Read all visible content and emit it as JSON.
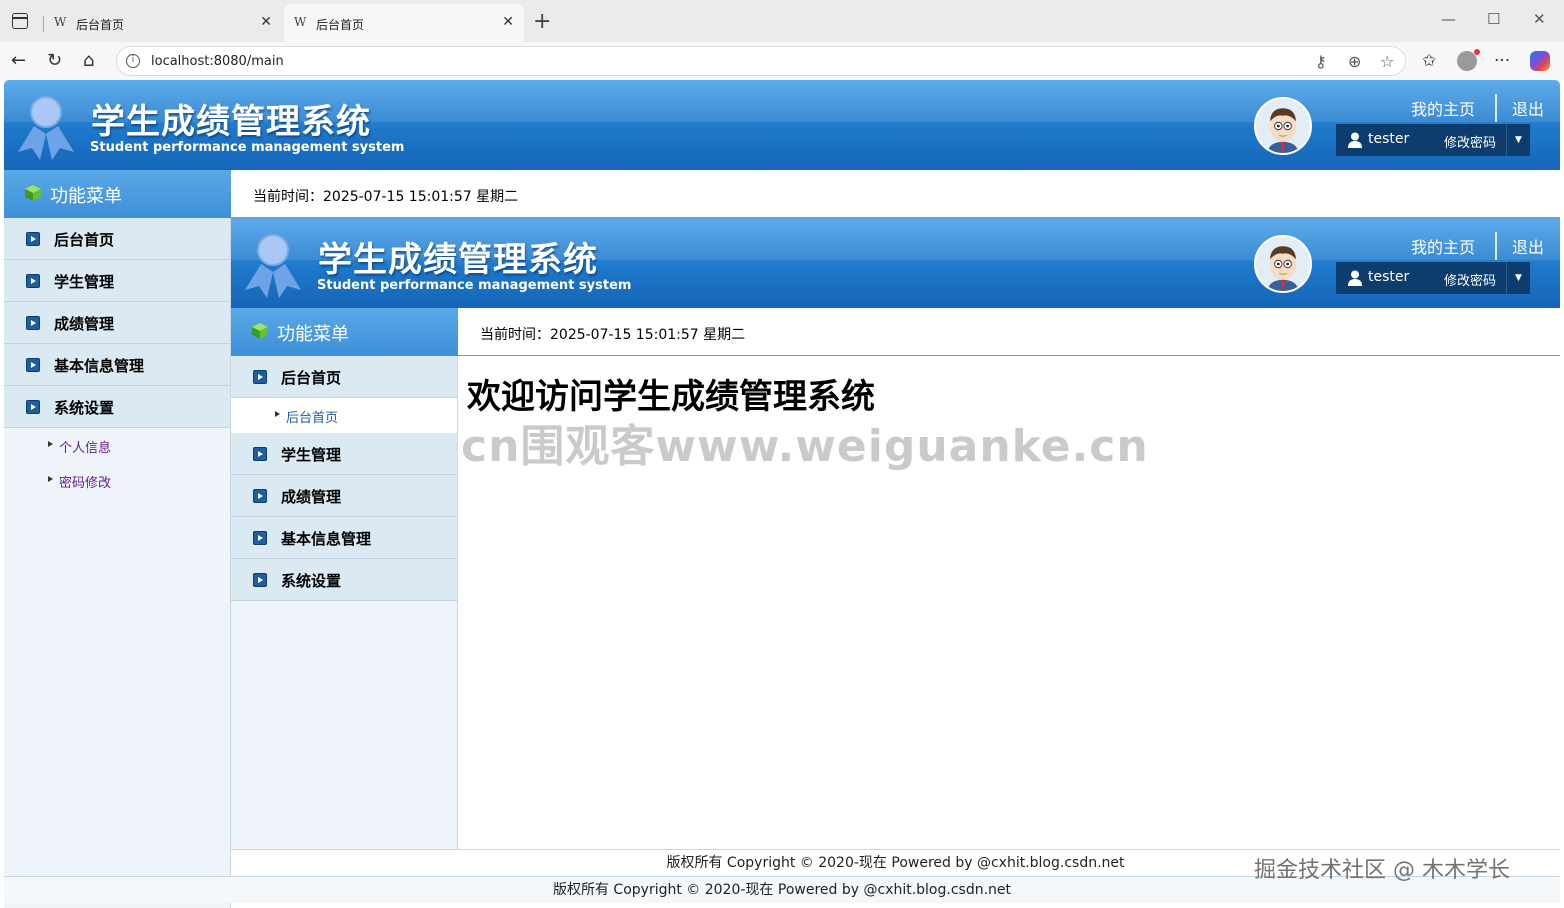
{
  "browser": {
    "tabs": [
      {
        "favicon": "W",
        "title": "后台首页"
      },
      {
        "favicon": "W",
        "title": "后台首页"
      }
    ],
    "url": "localhost:8080/main"
  },
  "header": {
    "title": "学生成绩管理系统",
    "subtitle": "Student performance management system",
    "my_home": "我的主页",
    "logout": "退出",
    "username": "tester",
    "change_password": "修改密码"
  },
  "menu": {
    "title": "功能菜单",
    "current_time": "当前时间：2025-07-15 15:01:57 星期二",
    "items": [
      {
        "label": "后台首页"
      },
      {
        "label": "学生管理"
      },
      {
        "label": "成绩管理"
      },
      {
        "label": "基本信息管理"
      },
      {
        "label": "系统设置"
      }
    ],
    "settings_sub": [
      {
        "label": "个人信息"
      },
      {
        "label": "密码修改"
      }
    ],
    "home_sub": [
      {
        "label": "后台首页"
      }
    ]
  },
  "content": {
    "welcome": "欢迎访问学生成绩管理系统"
  },
  "footer": {
    "text": "版权所有 Copyright © 2020-现在 Powered by @cxhit.blog.csdn.net"
  },
  "watermarks": {
    "main": "cn围观客www.weiguanke.cn",
    "corner": "掘金技术社区 @ 木木学长"
  },
  "colors": {
    "banner": "#1e78c9",
    "menu_head": "#3d8fd8",
    "sidebar_item": "#dbe9f3",
    "submenu_link": "#6a1b9a"
  },
  "icons": [
    "sidebar-toggle-icon",
    "back-icon",
    "reload-icon",
    "home-icon",
    "info-icon",
    "key-icon",
    "zoom-icon",
    "star-icon",
    "favorites-icon",
    "more-icon",
    "copilot-icon",
    "user-icon",
    "cube-icon",
    "expand-icon"
  ]
}
